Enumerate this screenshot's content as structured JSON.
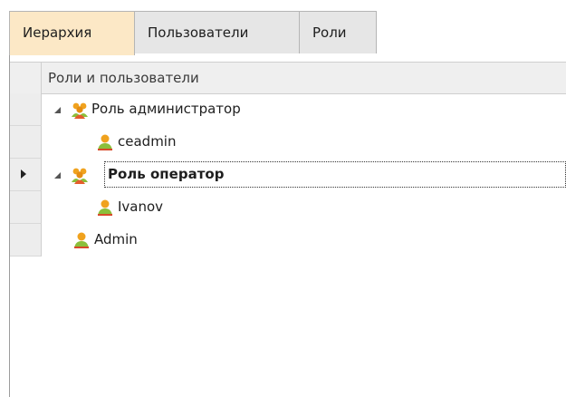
{
  "tabs": [
    "Иерархия",
    "Пользователи",
    "Роли"
  ],
  "grid": {
    "column_header": "Роли и пользователи",
    "rows": [
      {
        "label": "Роль администратор",
        "type": "role"
      },
      {
        "label": "ceadmin",
        "type": "user"
      },
      {
        "label": "Роль оператор",
        "type": "role",
        "selected": true
      },
      {
        "label": "Ivanov",
        "type": "user"
      },
      {
        "label": "Admin",
        "type": "user"
      }
    ]
  },
  "colors": {
    "active_tab": "#fce8c6",
    "user_icon": "#8bbf3b",
    "role_icon": "#f0a21e"
  }
}
